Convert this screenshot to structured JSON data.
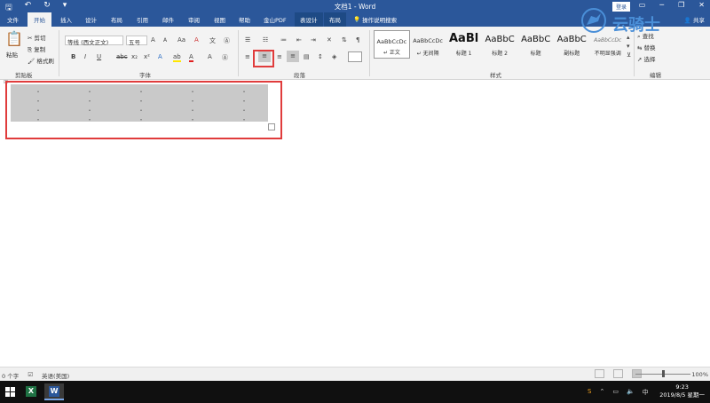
{
  "titlebar": {
    "title": "文档1 - Word",
    "login": "登录",
    "qat": {
      "save": "🖫",
      "undo": "↶",
      "redo": "↻",
      "customize": "▾"
    },
    "win": {
      "restore": "▭",
      "minimize": "─",
      "maximize": "❐",
      "close": "✕"
    }
  },
  "tabs": {
    "file": "文件",
    "home": "开始",
    "insert": "插入",
    "design": "设计",
    "layout": "布局",
    "references": "引用",
    "mailings": "邮件",
    "review": "审阅",
    "view": "视图",
    "help": "帮助",
    "wps_pdf": "金山PDF",
    "table_design": "表设计",
    "table_layout": "布局",
    "search": "操作说明搜索",
    "share": "共享"
  },
  "clipboard": {
    "paste": "粘贴",
    "cut": "剪切",
    "copy": "复制",
    "format_painter": "格式刷",
    "label": "剪贴板"
  },
  "font": {
    "name": "等线 (西文正文)",
    "size": "五号",
    "label": "字体",
    "bold": "B",
    "italic": "I",
    "underline": "U",
    "strike": "abc",
    "subscript": "x₂",
    "superscript": "x²",
    "grow": "A",
    "shrink": "A",
    "case": "Aa",
    "clear": "A",
    "highlight": "ab",
    "color": "A",
    "effects": "A"
  },
  "paragraph": {
    "label": "段落"
  },
  "styles": {
    "label": "样式",
    "items": [
      {
        "sample": "AaBbCcDc",
        "name": "↵ 正文"
      },
      {
        "sample": "AaBbCcDc",
        "name": "↵ 无间隔"
      },
      {
        "sample": "AaBl",
        "name": "标题 1"
      },
      {
        "sample": "AaBbC",
        "name": "标题 2"
      },
      {
        "sample": "AaBbC",
        "name": "标题"
      },
      {
        "sample": "AaBbC",
        "name": "副标题"
      },
      {
        "sample": "AaBbCcDc",
        "name": "不明显强调"
      }
    ]
  },
  "editing": {
    "label": "编辑",
    "find": "查找",
    "replace": "替换",
    "select": "选择"
  },
  "watermark": {
    "text": "云骑士"
  },
  "status": {
    "words": "0 个字",
    "language": "英语(美国)",
    "zoom": "100%"
  },
  "taskbar": {
    "time": "9:23",
    "date": "2019/8/5 星期一",
    "excel": "X",
    "word": "W"
  }
}
